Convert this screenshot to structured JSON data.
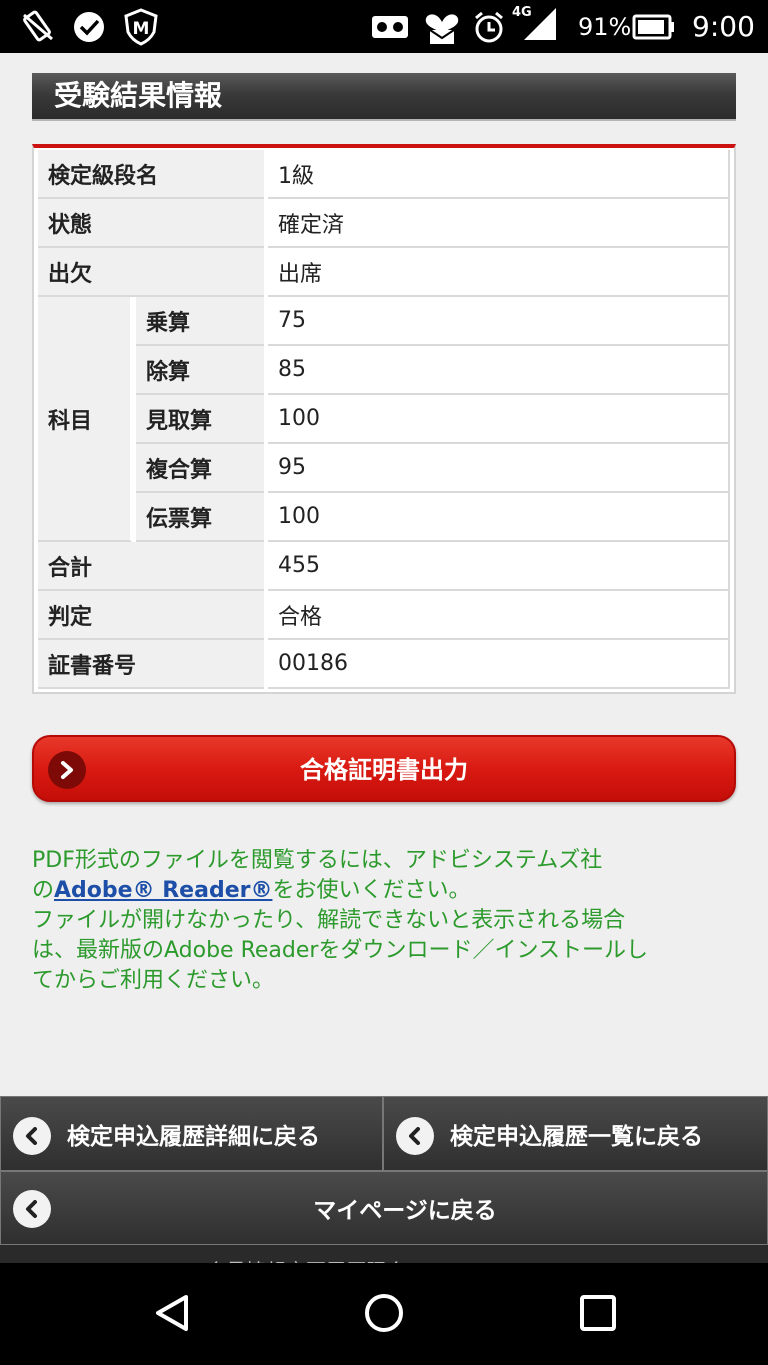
{
  "status_bar": {
    "icons": [
      "signal-off-icon",
      "check-circle-icon",
      "shield-m-icon",
      "vr-icon",
      "heart-mail-icon",
      "alarm-icon",
      "4g-signal-icon",
      "battery-icon"
    ],
    "network_label": "4G",
    "battery_percent": "91%",
    "time": "9:00"
  },
  "section": {
    "title": "受験結果情報"
  },
  "result_table": {
    "rows": [
      {
        "label": "検定級段名",
        "value": "1級"
      },
      {
        "label": "状態",
        "value": "確定済"
      },
      {
        "label": "出欠",
        "value": "出席"
      }
    ],
    "subjects_label": "科目",
    "subjects": [
      {
        "label": "乗算",
        "value": "75"
      },
      {
        "label": "除算",
        "value": "85"
      },
      {
        "label": "見取算",
        "value": "100"
      },
      {
        "label": "複合算",
        "value": "95"
      },
      {
        "label": "伝票算",
        "value": "100"
      }
    ],
    "summary_rows": [
      {
        "label": "合計",
        "value": "455"
      },
      {
        "label": "判定",
        "value": "合格"
      },
      {
        "label": "証書番号",
        "value": "00186"
      }
    ]
  },
  "pass_button": {
    "label": "合格証明書出力"
  },
  "note": {
    "line1": "PDF形式のファイルを閲覧するには、アドビシステムズ社",
    "line2_prefix": "の",
    "link_text": "Adobe® Reader®",
    "line2_suffix": "をお使いください。",
    "line3": "ファイルが開けなかったり、解読できないと表示される場合",
    "line4": "は、最新版のAdobe Readerをダウンロード／インストールし",
    "line5": "てからご利用ください。"
  },
  "nav_buttons": {
    "back_detail": "検定申込履歴詳細に戻る",
    "back_list": "検定申込履歴一覧に戻る",
    "back_mypage": "マイページに戻る"
  },
  "cut_off_text": "…会員情報変更履歴照会…",
  "colors": {
    "accent_red": "#d91a12",
    "note_green": "#2c9a2c",
    "link_blue": "#1d4fa8"
  }
}
